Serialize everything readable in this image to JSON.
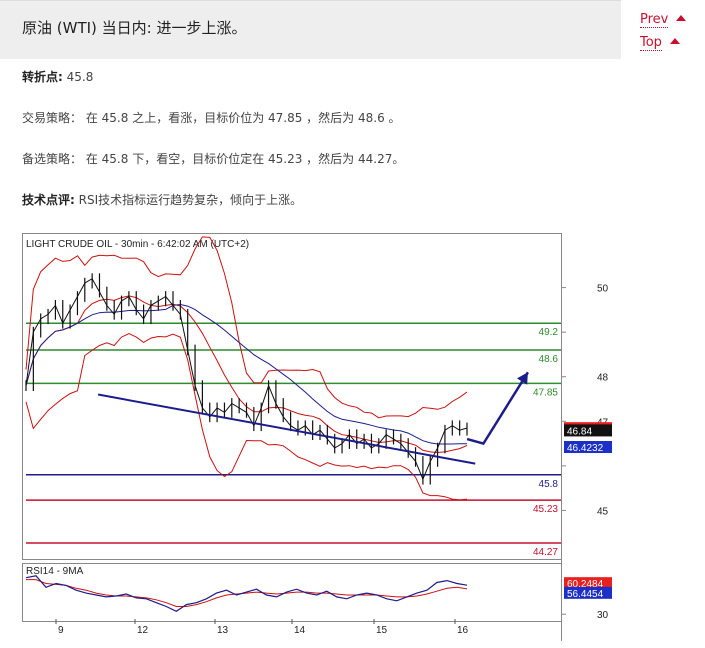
{
  "header": {
    "title": "原油 (WTI) 当日内: 进一步上涨。"
  },
  "nav": {
    "prev_label": "Prev",
    "top_label": "Top"
  },
  "content": {
    "pivot_label": "转折点:",
    "pivot_value": "45.8",
    "strategy_label": "交易策略：",
    "strategy_text": "在 45.8 之上，看涨，目标价位为 47.85 ，然后为 48.6 。",
    "alt_label": "备选策略：",
    "alt_text": "在 45.8 下，看空，目标价位定在 45.23 ，然后为 44.27。",
    "tech_label": "技术点评:",
    "tech_text": "RSI技术指标运行趋势复杂，倾向于上涨。"
  },
  "chart_data": {
    "type": "line",
    "title": "LIGHT CRUDE OIL - 30min - 6:42:02 AM (UTC+2)",
    "x_ticks": [
      "9",
      "12",
      "13",
      "14",
      "15",
      "16"
    ],
    "price_axis": {
      "ylim": [
        44.0,
        51.0
      ],
      "ticks": [
        45,
        46,
        47,
        48,
        49,
        50
      ],
      "tick_labels": [
        "45",
        "",
        "47",
        "48",
        "",
        "50"
      ]
    },
    "price_series": [
      47.8,
      49.0,
      49.3,
      49.4,
      49.6,
      49.2,
      49.5,
      49.8,
      50.1,
      50.2,
      49.9,
      49.6,
      49.4,
      49.7,
      49.8,
      49.5,
      49.3,
      49.6,
      49.7,
      49.8,
      49.6,
      49.4,
      48.6,
      47.8,
      47.3,
      47.1,
      47.3,
      47.2,
      47.4,
      47.3,
      47.2,
      46.9,
      47.3,
      47.8,
      47.4,
      47.1,
      46.9,
      46.8,
      46.9,
      46.7,
      46.8,
      46.6,
      46.4,
      46.5,
      46.7,
      46.5,
      46.6,
      46.4,
      46.5,
      46.7,
      46.6,
      46.5,
      46.3,
      46.1,
      45.7,
      46.1,
      46.4,
      46.8,
      46.9,
      46.8,
      46.85
    ],
    "horizontal_levels": [
      {
        "value": 49.2,
        "label": "49.2",
        "color": "#2e8b2e"
      },
      {
        "value": 48.6,
        "label": "48.6",
        "color": "#2e8b2e"
      },
      {
        "value": 47.85,
        "label": "47.85",
        "color": "#2e8b2e"
      },
      {
        "value": 45.8,
        "label": "45.8",
        "color": "#1c1c8c"
      },
      {
        "value": 45.23,
        "label": "45.23",
        "color": "#c8102e"
      },
      {
        "value": 44.27,
        "label": "44.27",
        "color": "#c8102e"
      }
    ],
    "price_tags": [
      {
        "value": 46.8456,
        "label": "46.8456",
        "bg": "#e8201e",
        "fg": "#ffffff"
      },
      {
        "value": 46.84,
        "label": "46.84",
        "bg": "#111111",
        "fg": "#ffffff"
      },
      {
        "value": 46.4232,
        "label": "46.4232",
        "bg": "#1c30c8",
        "fg": "#ffffff"
      }
    ],
    "trendline": {
      "from": [
        10.6,
        47.6
      ],
      "to": [
        16.25,
        46.05
      ]
    },
    "projection_arrow": [
      [
        16.15,
        46.6
      ],
      [
        16.35,
        46.5
      ],
      [
        16.9,
        48.1
      ]
    ],
    "rsi": {
      "label": "RSI14 - 9MA",
      "ylim": [
        25,
        75
      ],
      "ticks": [
        30
      ],
      "tick_labels": [
        "30"
      ],
      "rsi_values": [
        68,
        70,
        58,
        62,
        60,
        55,
        52,
        50,
        48,
        49,
        51,
        47,
        46,
        42,
        38,
        33,
        40,
        42,
        46,
        52,
        55,
        50,
        53,
        56,
        50,
        48,
        53,
        56,
        52,
        50,
        54,
        48,
        46,
        50,
        52,
        50,
        46,
        44,
        48,
        52,
        55,
        63,
        65,
        62,
        60.2
      ],
      "ma_values": [
        66,
        66,
        62,
        61,
        60,
        57,
        55,
        52,
        50,
        49,
        49,
        48,
        47,
        45,
        42,
        38,
        38,
        40,
        43,
        47,
        50,
        51,
        52,
        53,
        52,
        51,
        52,
        53,
        53,
        52,
        52,
        51,
        50,
        50,
        50,
        50,
        49,
        48,
        48,
        49,
        51,
        54,
        57,
        58,
        56.4
      ],
      "tags": [
        {
          "value": 60.2484,
          "label": "60.2484",
          "bg": "#e8201e",
          "fg": "#ffffff"
        },
        {
          "value": 56.4454,
          "label": "56.4454",
          "bg": "#1c30c8",
          "fg": "#ffffff"
        }
      ]
    },
    "colors": {
      "price": "#111111",
      "bollinger": "#cc1111",
      "ma": "#1c1c8c",
      "rsi": "#1c1c8c",
      "rsi_ma": "#cc1111"
    }
  }
}
